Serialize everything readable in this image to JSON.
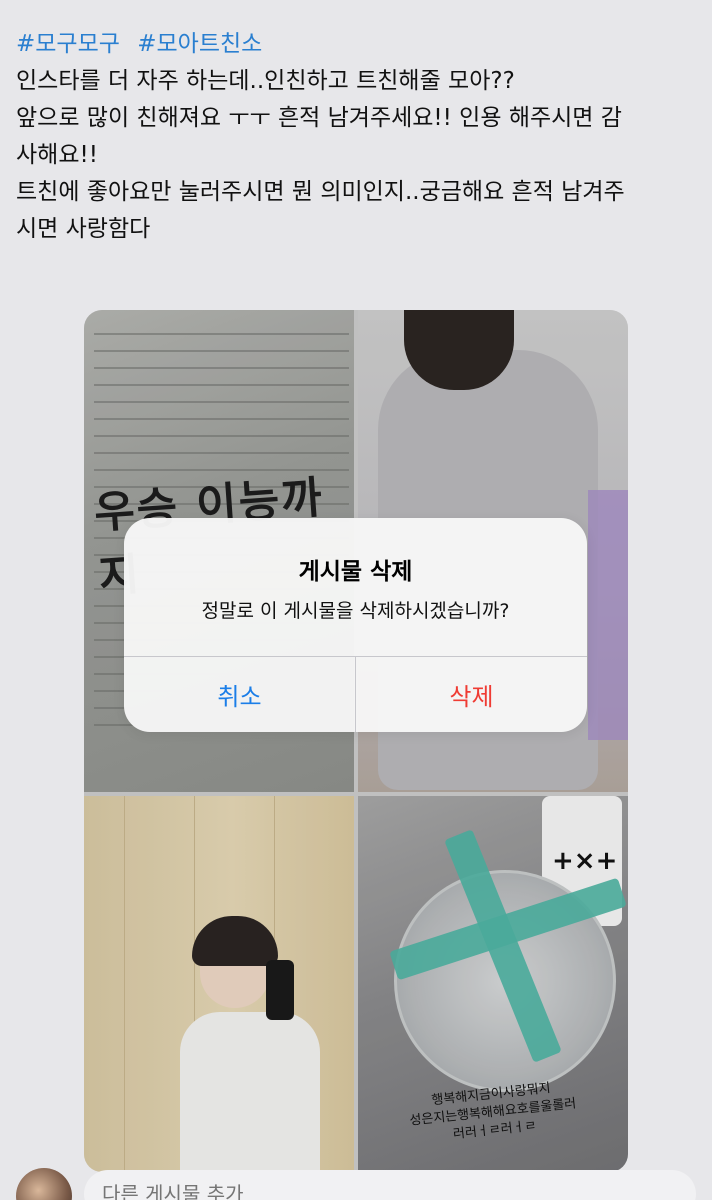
{
  "tweet": {
    "hashtags": [
      "#모구모구",
      "#모아트친소"
    ],
    "lines": [
      "인스타를 더 자주 하는데..인친하고 트친해줄 모아??",
      "앞으로 많이 친해져요 ㅜㅜ 흔적 남겨주세요!! 인용 해주시면 감",
      "사해요!!",
      "트친에 좋아요만 눌러주시면 뭔 의미인지..궁금해요 흔적 남겨주",
      "시면 사랑함다"
    ]
  },
  "media": {
    "tile1_handwriting": "우승 이능까지",
    "tile4_bottle_logo": "+×+",
    "tile4_note_lines": [
      "행복해지금이사랑뭐지",
      "성은지는행복해해요호를울롤러",
      "러러ㅓㄹ러ㅓㄹ"
    ]
  },
  "alert": {
    "title": "게시물 삭제",
    "message": "정말로 이 게시물을 삭제하시겠습니까?",
    "cancel_label": "취소",
    "delete_label": "삭제"
  },
  "compose": {
    "placeholder": "다른 게시물 추가"
  },
  "colors": {
    "hashtag": "#2a7fd0",
    "cancel": "#1b7ee8",
    "destructive": "#ef3b33",
    "background": "#e7e7ea"
  }
}
